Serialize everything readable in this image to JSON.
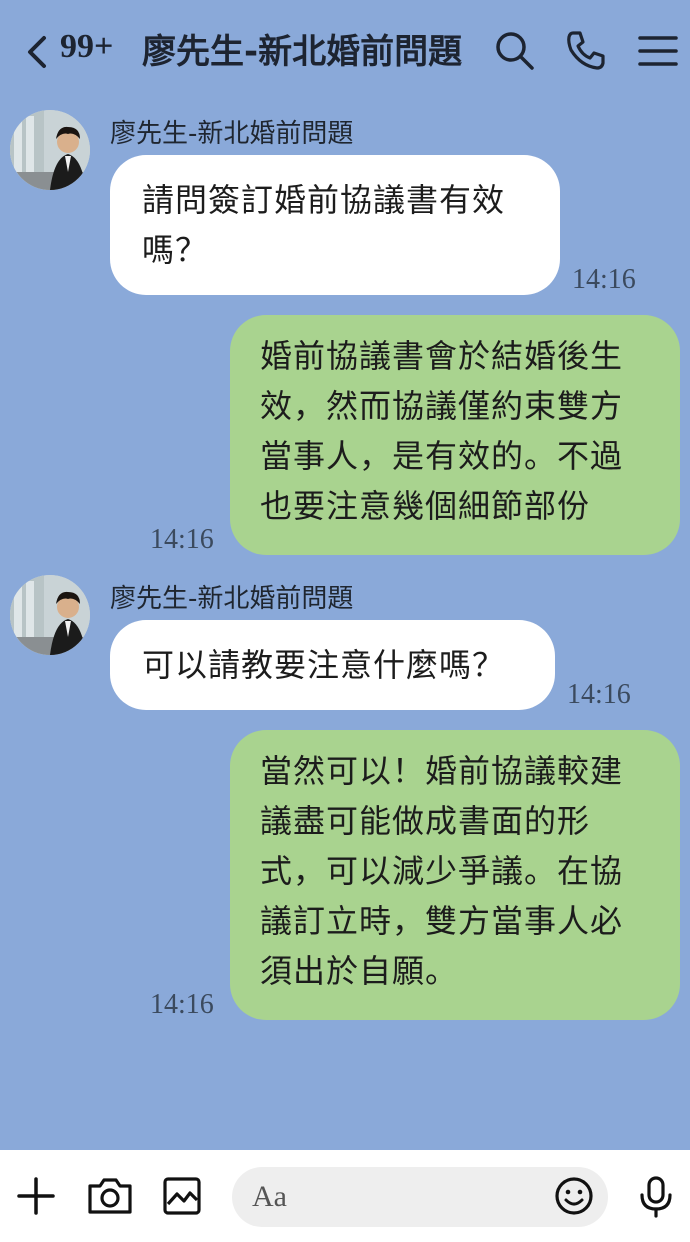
{
  "header": {
    "unread_count": "99+",
    "chat_title": "廖先生-新北婚前問題"
  },
  "messages": [
    {
      "direction": "in",
      "sender": "廖先生-新北婚前問題",
      "text": "請問簽訂婚前協議書有效\n嗎？",
      "time": "14:16"
    },
    {
      "direction": "out",
      "text": "婚前協議書會於結婚後生\n效，然而協議僅約束雙方\n當事人，是有效的。不過\n也要注意幾個細節部份",
      "time": "14:16"
    },
    {
      "direction": "in",
      "sender": "廖先生-新北婚前問題",
      "text": "可以請教要注意什麼嗎？",
      "time": "14:16"
    },
    {
      "direction": "out",
      "text": "當然可以！婚前協議較建\n議盡可能做成書面的形\n式，可以減少爭議。在協\n議訂立時，雙方當事人必\n須出於自願。",
      "time": "14:16"
    }
  ],
  "input": {
    "placeholder": "Aa"
  },
  "icons": {
    "header": [
      "back-icon",
      "search-icon",
      "phone-icon",
      "menu-icon"
    ],
    "bottom": [
      "plus-icon",
      "camera-icon",
      "image-icon",
      "emoji-icon",
      "mic-icon"
    ]
  },
  "colors": {
    "background": "#8aa9d9",
    "incoming_bubble": "#ffffff",
    "outgoing_bubble": "#a9d38f"
  }
}
